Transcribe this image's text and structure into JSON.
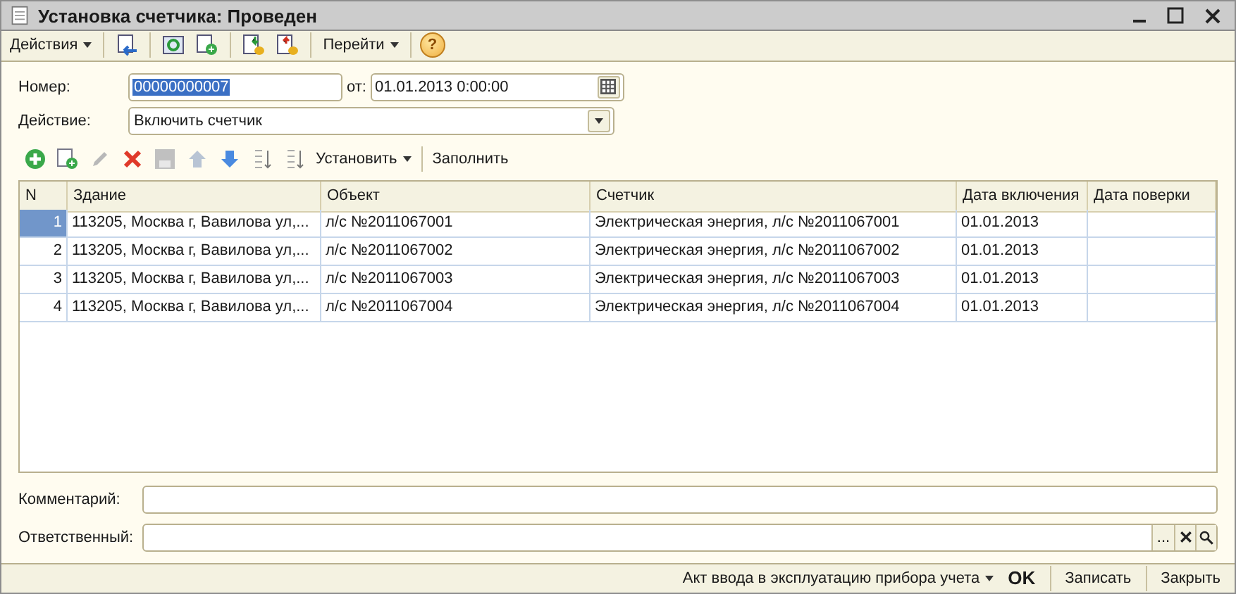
{
  "window": {
    "title": "Установка счетчика: Проведен"
  },
  "toolbar": {
    "actions_menu": "Действия",
    "goto_menu": "Перейти",
    "help": "?"
  },
  "form": {
    "number": {
      "label": "Номер:",
      "value": "00000000007",
      "highlighted": true
    },
    "date": {
      "label": "от:",
      "value": "01.01.2013  0:00:00"
    },
    "action": {
      "label": "Действие:",
      "value": "Включить счетчик"
    }
  },
  "table_toolbar": {
    "set_menu": "Установить",
    "fill_button": "Заполнить"
  },
  "table": {
    "columns": [
      "N",
      "Здание",
      "Объект",
      "Счетчик",
      "Дата включения",
      "Дата поверки"
    ],
    "rows": [
      {
        "selected": true,
        "cells": [
          "1",
          "113205, Москва г, Вавилова ул,...",
          "л/с №2011067001",
          "Электрическая энергия, л/с №2011067001",
          "01.01.2013",
          ""
        ]
      },
      {
        "selected": false,
        "cells": [
          "2",
          "113205, Москва г, Вавилова ул,...",
          "л/с №2011067002",
          "Электрическая энергия, л/с №2011067002",
          "01.01.2013",
          ""
        ]
      },
      {
        "selected": false,
        "cells": [
          "3",
          "113205, Москва г, Вавилова ул,...",
          "л/с №2011067003",
          "Электрическая энергия, л/с №2011067003",
          "01.01.2013",
          ""
        ]
      },
      {
        "selected": false,
        "cells": [
          "4",
          "113205, Москва г, Вавилова ул,...",
          "л/с №2011067004",
          "Электрическая энергия, л/с №2011067004",
          "01.01.2013",
          ""
        ]
      }
    ]
  },
  "comment": {
    "label": "Комментарий:"
  },
  "responsible": {
    "label": "Ответственный:",
    "choose": "..."
  },
  "footer": {
    "print_menu": "Акт ввода в эксплуатацию прибора учета",
    "ok": "OK",
    "save": "Записать",
    "close": "Закрыть"
  }
}
